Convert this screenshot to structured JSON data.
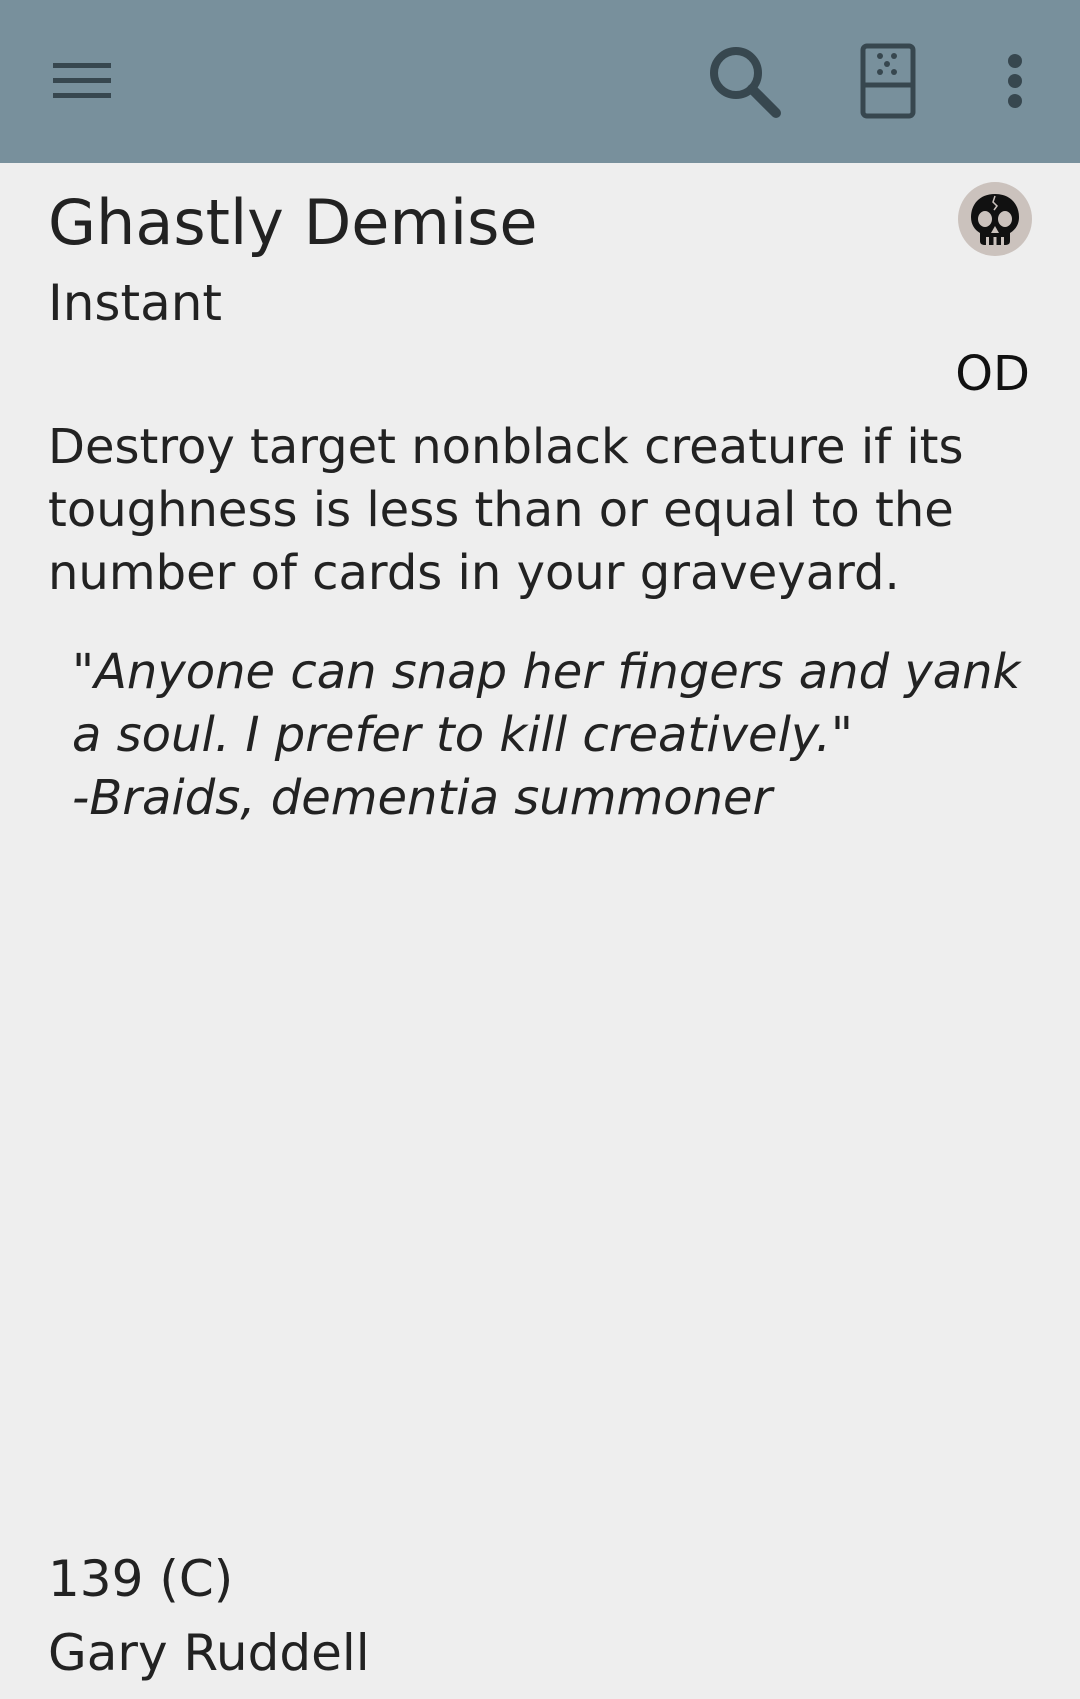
{
  "toolbar": {
    "icons": [
      "menu-icon",
      "search-icon",
      "random-card-icon",
      "more-vert-icon"
    ],
    "background_color": "#78909c",
    "icon_color": "#37474f"
  },
  "card": {
    "name": "Ghastly Demise",
    "mana_symbol": "black-mana-skull-icon",
    "type": "Instant",
    "set_code": "OD",
    "rules_text": "Destroy target nonblack creature if its toughness is less than or equal to the number of cards in your graveyard.",
    "flavor_lines": [
      "\"Anyone can snap her fingers and yank",
      "a soul. I prefer to kill creatively.\"",
      "-Braids, dementia summoner"
    ],
    "collector_number": "139 (C)",
    "artist": "Gary Ruddell"
  }
}
